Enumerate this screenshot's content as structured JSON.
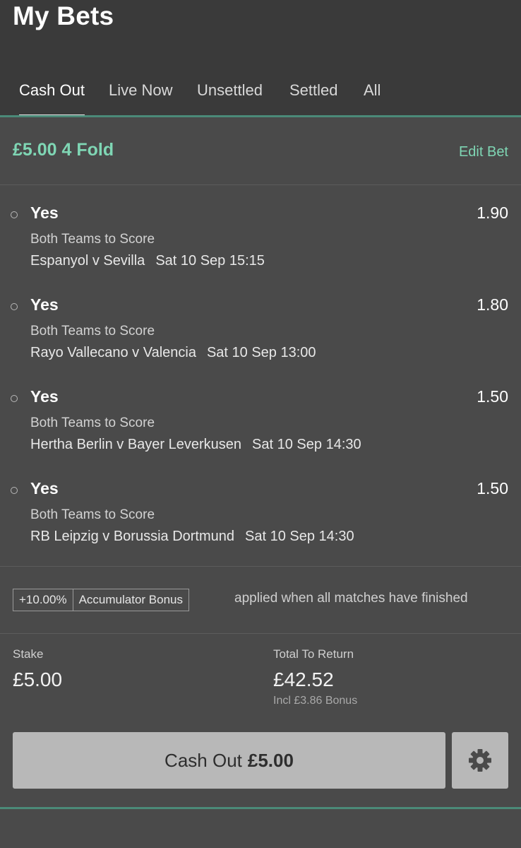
{
  "header": {
    "title": "My Bets",
    "tabs": [
      {
        "label": "Cash Out",
        "active": true
      },
      {
        "label": "Live Now",
        "active": false
      },
      {
        "label": "Unsettled",
        "active": false
      },
      {
        "label": "Settled",
        "active": false
      },
      {
        "label": "All",
        "active": false
      }
    ]
  },
  "bet": {
    "title": "£5.00 4 Fold",
    "edit_label": "Edit Bet",
    "selections": [
      {
        "name": "Yes",
        "odds": "1.90",
        "market": "Both Teams to Score",
        "event": "Espanyol v Sevilla",
        "time": "Sat 10 Sep 15:15"
      },
      {
        "name": "Yes",
        "odds": "1.80",
        "market": "Both Teams to Score",
        "event": "Rayo Vallecano v Valencia",
        "time": "Sat 10 Sep 13:00"
      },
      {
        "name": "Yes",
        "odds": "1.50",
        "market": "Both Teams to Score",
        "event": "Hertha Berlin v Bayer Leverkusen",
        "time": "Sat 10 Sep 14:30"
      },
      {
        "name": "Yes",
        "odds": "1.50",
        "market": "Both Teams to Score",
        "event": "RB Leipzig v Borussia Dortmund",
        "time": "Sat 10 Sep 14:30"
      }
    ],
    "bonus": {
      "percent": "+10.00%",
      "label": "Accumulator Bonus",
      "note": "applied when all matches have finished"
    },
    "stake": {
      "label": "Stake",
      "value": "£5.00"
    },
    "total_return": {
      "label": "Total To Return",
      "value": "£42.52",
      "bonus_note": "Incl £3.86 Bonus"
    },
    "cashout": {
      "label": "Cash Out",
      "amount": "£5.00"
    }
  },
  "colors": {
    "accent": "#7fd6b4",
    "rule": "#4b8a78",
    "header_bg": "#3a3a3a",
    "body_bg": "#4a4a4a",
    "button_bg": "#b8b8b8"
  },
  "icons": {
    "settings": "gear-icon"
  }
}
